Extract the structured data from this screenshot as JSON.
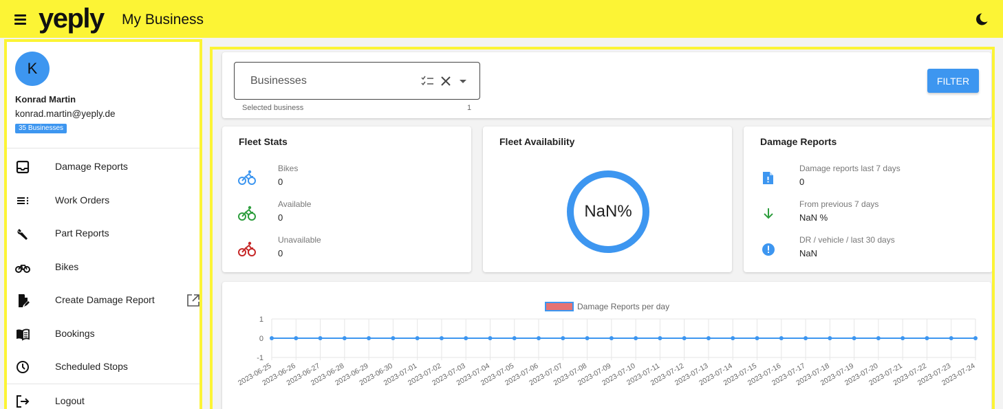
{
  "header": {
    "logo": "yeply",
    "title": "My Business"
  },
  "user": {
    "initial": "K",
    "name": "Konrad Martin",
    "email": "konrad.martin@yeply.de",
    "businesses_badge": "35 Businesses"
  },
  "nav": {
    "items": [
      {
        "label": "Damage Reports",
        "icon": "inbox-icon"
      },
      {
        "label": "Work Orders",
        "icon": "list-icon"
      },
      {
        "label": "Part Reports",
        "icon": "wrench-icon"
      },
      {
        "label": "Bikes",
        "icon": "bike-icon"
      },
      {
        "label": "Create Damage Report",
        "icon": "file-edit-icon",
        "external": true
      },
      {
        "label": "Bookings",
        "icon": "book-icon"
      },
      {
        "label": "Scheduled Stops",
        "icon": "clock-icon"
      }
    ],
    "logout": "Logout"
  },
  "filter": {
    "placeholder": "Businesses",
    "hint": "Selected business",
    "count": "1",
    "button": "FILTER"
  },
  "fleet_stats": {
    "title": "Fleet Stats",
    "rows": [
      {
        "label": "Bikes",
        "value": "0",
        "color": "#3d96f0"
      },
      {
        "label": "Available",
        "value": "0",
        "color": "#2e9e3e"
      },
      {
        "label": "Unavailable",
        "value": "0",
        "color": "#c62828"
      }
    ]
  },
  "fleet_availability": {
    "title": "Fleet Availability",
    "value": "NaN%",
    "ring_color": "#3d96f0"
  },
  "damage_reports": {
    "title": "Damage Reports",
    "rows": [
      {
        "label": "Damage reports last 7 days",
        "value": "0",
        "icon": "report-icon"
      },
      {
        "label": "From previous 7 days",
        "value": "NaN %",
        "icon": "arrow-down-icon"
      },
      {
        "label": "DR / vehicle / last 30 days",
        "value": "NaN",
        "icon": "alert-icon"
      }
    ]
  },
  "chart_data": {
    "type": "line",
    "title": "",
    "legend": "Damage Reports per day",
    "legend_color": "#e57373",
    "line_color": "#3d96f0",
    "x": [
      "2023-06-25",
      "2023-06-26",
      "2023-06-27",
      "2023-06-28",
      "2023-06-29",
      "2023-06-30",
      "2023-07-01",
      "2023-07-02",
      "2023-07-03",
      "2023-07-04",
      "2023-07-05",
      "2023-07-06",
      "2023-07-07",
      "2023-07-08",
      "2023-07-09",
      "2023-07-10",
      "2023-07-11",
      "2023-07-12",
      "2023-07-13",
      "2023-07-14",
      "2023-07-15",
      "2023-07-16",
      "2023-07-17",
      "2023-07-18",
      "2023-07-19",
      "2023-07-20",
      "2023-07-21",
      "2023-07-22",
      "2023-07-23",
      "2023-07-24"
    ],
    "series": [
      {
        "name": "Damage Reports per day",
        "values": [
          0,
          0,
          0,
          0,
          0,
          0,
          0,
          0,
          0,
          0,
          0,
          0,
          0,
          0,
          0,
          0,
          0,
          0,
          0,
          0,
          0,
          0,
          0,
          0,
          0,
          0,
          0,
          0,
          0,
          0
        ]
      }
    ],
    "y_ticks": [
      "1",
      "0",
      "-1"
    ],
    "ylim": [
      -1,
      1
    ],
    "grid": true
  }
}
